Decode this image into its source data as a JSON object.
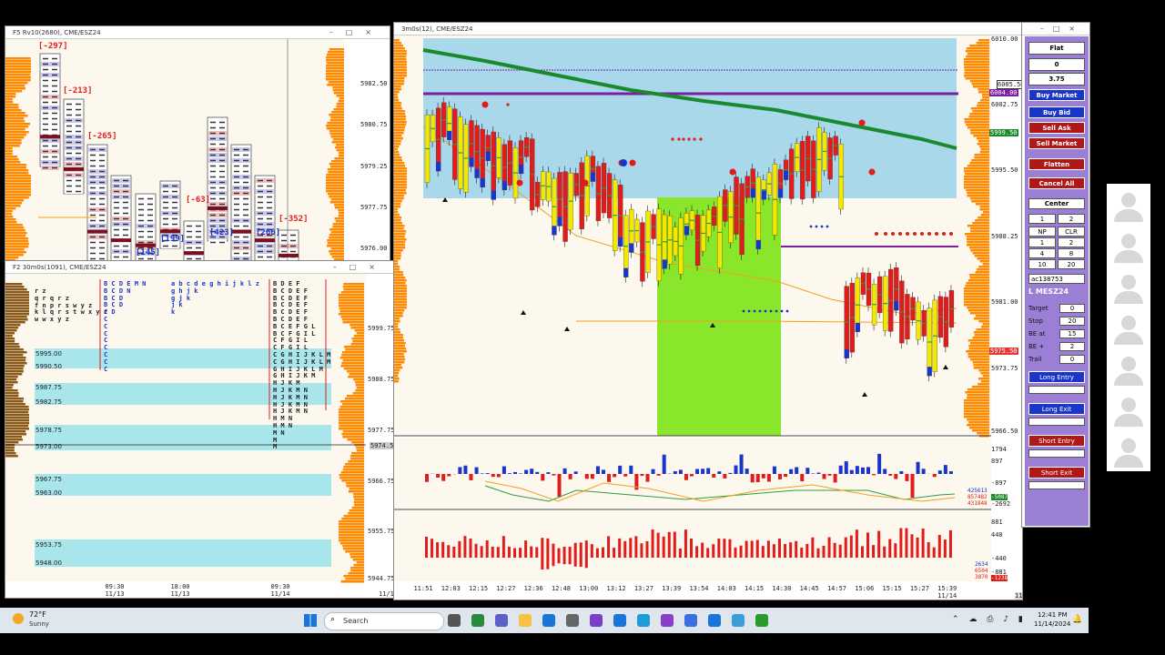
{
  "left_top_window": {
    "title": "F5 Rv10(2680), CME/ESZ24",
    "prices": [
      "5982.50",
      "5980.75",
      "5979.25",
      "5977.75",
      "5976.00"
    ],
    "deltas": [
      "[-297]",
      "[-213]",
      "[-265]",
      "[145]",
      "[199]",
      "[-63]",
      "[423]",
      "[266]",
      "[-352]"
    ]
  },
  "left_bottom_window": {
    "title": "F2 30m0s(1091), CME/ESZ24",
    "prices": [
      "5999.75",
      "5988.75",
      "5977.75",
      "5966.75",
      "5955.75",
      "5944.75"
    ],
    "current_price": "5974.50",
    "levels": [
      "5995.00",
      "5990.50",
      "5987.75",
      "5982.75",
      "5978.75",
      "5973.00",
      "5967.75",
      "5963.00",
      "5953.75",
      "5948.00"
    ],
    "time_labels": [
      {
        "time": "09:30",
        "date": "11/13"
      },
      {
        "time": "18:00",
        "date": "11/13"
      },
      {
        "time": "09:30",
        "date": "11/14"
      }
    ],
    "profile1": "r z\nq r q r z\nf n p r s w y z\nk l q r s t w x y z\nw w x y z",
    "profile2": "B C D E M N\nB C D N\nB C D\nB C D\nC D\nC\nC\nC\nC\nC\nC\nC\nC",
    "profile3": "a b c d e g h i j k l z\ng h j k\ng j k\nj k\nk",
    "profile4": "B D E F\nB C D E F\nB C D E F\nB C D E F\nB C D E F\nB C D E F\nB C E F G L\nB C F G I L\nC F G I L\nC F G I L\nC G H I J K L M\nC G H I J K L M\nG H I J K L M\nG H I J K M\nH J K M\nH J K M N\nH J K M N\nH J K M N\nH J K M N\nH M N\nH M N\nM N\nM\nM",
    "date_footer": "11/14"
  },
  "main_window": {
    "title": "3m0s(12), CME/ESZ24",
    "prices": [
      "6010.00",
      "6005.50",
      "6002.75",
      "5995.50",
      "5988.25",
      "5981.00",
      "5973.75",
      "5966.50"
    ],
    "tags": [
      {
        "text": "6004.00",
        "color": "#7a1fa2"
      },
      {
        "text": "5999.50",
        "color": "#1b8a2f"
      },
      {
        "text": "5975.50",
        "color": "#e53935"
      }
    ],
    "time_labels": [
      "11:51",
      "12:03",
      "12:15",
      "12:27",
      "12:36",
      "12:48",
      "13:00",
      "13:12",
      "13:27",
      "13:39",
      "13:54",
      "14:03",
      "14:15",
      "14:30",
      "14:45",
      "14:57",
      "15:06",
      "15:15",
      "15:27",
      "15:39"
    ],
    "last_date": "11/14",
    "footer_time": "11/14 15:30",
    "osc1_scale": [
      "1794",
      "897",
      "-897",
      "-2692"
    ],
    "osc1_values": [
      "425613",
      "857482",
      "431848",
      "-5087"
    ],
    "osc2_scale": [
      "881",
      "440",
      "-440",
      "-881"
    ],
    "osc2_values": [
      "2634",
      "6504",
      "3870",
      "-1238"
    ]
  },
  "order_panel": {
    "position": "Flat",
    "quantity": "0",
    "value": "3.75",
    "buy_market": "Buy Market",
    "buy_bid": "Buy Bid",
    "sell_ask": "Sell Ask",
    "sell_market": "Sell Market",
    "flatten": "Flatten",
    "cancel_all": "Cancel All",
    "center": "Center",
    "qty_a": "1",
    "qty_b": "2",
    "grid": [
      [
        "NP",
        "CLR"
      ],
      [
        "1",
        "2"
      ],
      [
        "4",
        "8"
      ],
      [
        "10",
        "20"
      ]
    ],
    "account": "ac138753",
    "symbol": "L MESZ24",
    "target_label": "Target",
    "target_val": "0",
    "stop_label": "Stop",
    "stop_val": "20",
    "beat_label": "BE at",
    "beat_val": "15",
    "beplus_label": "BE +",
    "beplus_val": "2",
    "trail_label": "Trail",
    "trail_val": "0",
    "long_entry": "Long Entry",
    "long_exit": "Long Exit",
    "short_entry": "Short Entry",
    "short_exit": "Short Exit"
  },
  "taskbar": {
    "weather_temp": "72°F",
    "weather_desc": "Sunny",
    "search_placeholder": "Search",
    "clock_time": "12:41 PM",
    "clock_date": "11/14/2024"
  },
  "colors": {
    "up_candle": "#f5e800",
    "down_candle": "#e21b1b",
    "value_area": "#8ae62a",
    "session_bg": "#a9d8ea",
    "profile_orange": "#ff8a00",
    "panel_bg": "#9b7fd4"
  }
}
